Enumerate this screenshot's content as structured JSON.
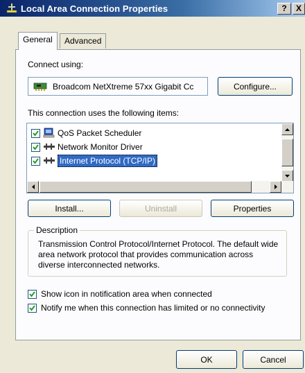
{
  "window": {
    "title": "Local Area Connection Properties",
    "help_label": "?",
    "close_label": "X"
  },
  "tabs": [
    {
      "label": "General"
    },
    {
      "label": "Advanced"
    }
  ],
  "connect_using": {
    "label": "Connect using:",
    "adapter": "Broadcom NetXtreme 57xx Gigabit Cc",
    "configure_label": "Configure..."
  },
  "items_section": {
    "label": "This connection uses the following items:",
    "items": [
      {
        "label": "QoS Packet Scheduler",
        "checked": true,
        "icon": "qos-scheduler-icon"
      },
      {
        "label": "Network Monitor Driver",
        "checked": true,
        "icon": "network-protocol-icon"
      },
      {
        "label": "Internet Protocol (TCP/IP)",
        "checked": true,
        "icon": "network-protocol-icon",
        "selected": true
      }
    ]
  },
  "actions": {
    "install": "Install...",
    "uninstall": "Uninstall",
    "properties": "Properties"
  },
  "description": {
    "title": "Description",
    "text": "Transmission Control Protocol/Internet Protocol. The default wide area network protocol that provides communication across diverse interconnected networks."
  },
  "options": [
    {
      "label": "Show icon in notification area when connected",
      "checked": true
    },
    {
      "label": "Notify me when this connection has limited or no connectivity",
      "checked": true
    }
  ],
  "footer": {
    "ok": "OK",
    "cancel": "Cancel"
  },
  "colors": {
    "selection": "#316ac5",
    "title_bar": "#0a246a"
  }
}
